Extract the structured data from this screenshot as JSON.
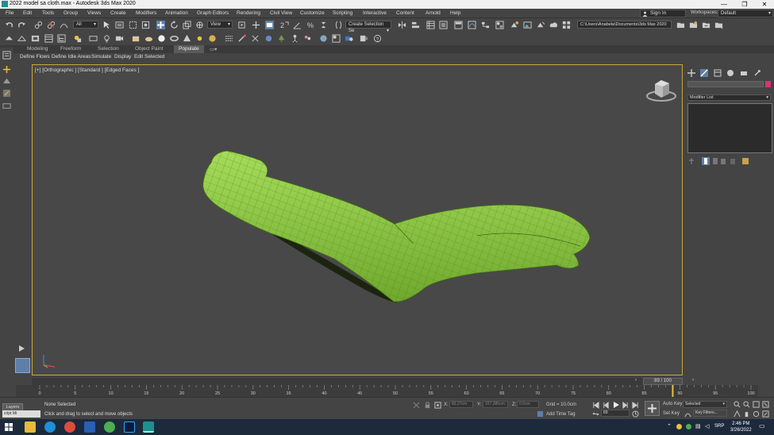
{
  "window": {
    "title": "2022 model sa cloth.max - Autodesk 3ds Max 2020"
  },
  "menu": {
    "items": [
      "File",
      "Edit",
      "Tools",
      "Group",
      "Views",
      "Create",
      "Modifiers",
      "Animation",
      "Graph Editors",
      "Rendering",
      "Civil View",
      "Customize",
      "Scripting",
      "Interactive",
      "Content",
      "Arnold",
      "Help"
    ],
    "sign_in": "Sign In",
    "workspaces_label": "Workspaces:",
    "workspaces_value": "Default"
  },
  "toolbar": {
    "selection_filter": "All",
    "ref_coord": "View",
    "named_selection": "Create Selection Se",
    "project_path": "C:\\Users\\Anabela\\Documents\\3ds Max 2020"
  },
  "ribbon": {
    "tabs": [
      "Modeling",
      "Freeform",
      "Selection",
      "Object Paint",
      "Populate"
    ],
    "active_tab": "Populate",
    "row_items": [
      "Define Flows",
      "Define Idle Areas",
      "Simulate",
      "Display",
      "Edit Selected"
    ]
  },
  "viewport": {
    "label": "[+] [Orthographic ] [Standard ] [Edged Faces ]",
    "model_color": "#8fcf3a"
  },
  "command_panel": {
    "modifier_list": "Modifier List",
    "object_color": "#d8327a"
  },
  "timeline": {
    "frame_display": "89 / 100",
    "current_frame": 89,
    "total_frames": 100,
    "ticks": [
      "0",
      "5",
      "10",
      "15",
      "20",
      "25",
      "30",
      "35",
      "40",
      "45",
      "50",
      "55",
      "60",
      "65",
      "70",
      "75",
      "80",
      "85",
      "90",
      "95",
      "100"
    ]
  },
  "status": {
    "layers_button": "Layers",
    "script_text": "cript Mi",
    "selection": "None Selected",
    "prompt": "Click and drag to select and move objects",
    "x_label": "X:",
    "y_label": "Y:",
    "z_label": "Z:",
    "x_value": "83.27cm",
    "y_value": "167.385cm",
    "z_value": "0.0cm",
    "grid": "Grid = 10.0cm",
    "add_time_tag": "Add Time Tag",
    "frame_value": "89",
    "auto_key": "Auto Key",
    "set_key": "Set Key",
    "key_mode": "Selected",
    "key_filters": "Key Filters..."
  },
  "taskbar": {
    "lang": "SRP",
    "time": "2:46 PM",
    "date": "3/26/2022"
  }
}
